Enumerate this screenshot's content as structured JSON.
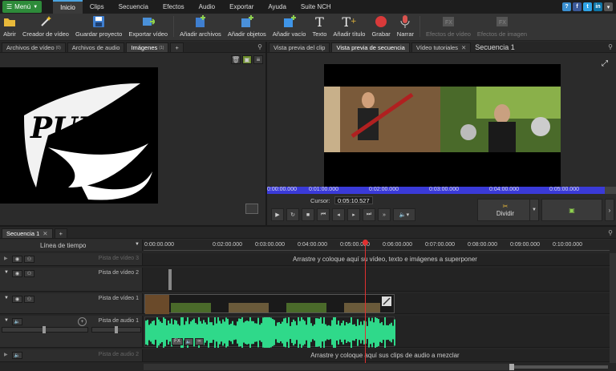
{
  "menubar": {
    "menu_label": "Menú",
    "tabs": [
      "Inicio",
      "Clips",
      "Secuencia",
      "Efectos",
      "Audio",
      "Exportar",
      "Ayuda",
      "Suite NCH"
    ],
    "social": [
      {
        "icon": "help-icon",
        "glyph": "?",
        "color": "#3a8fd0"
      },
      {
        "icon": "facebook-icon",
        "glyph": "f",
        "color": "#3b5998"
      },
      {
        "icon": "twitter-icon",
        "glyph": "t",
        "color": "#2ea3e6"
      },
      {
        "icon": "linkedin-icon",
        "glyph": "in",
        "color": "#0e76a8"
      },
      {
        "icon": "more-icon",
        "glyph": "▾",
        "color": "#555"
      }
    ]
  },
  "toolbar": {
    "items": [
      {
        "label": "Abrir",
        "icon": "folder-icon"
      },
      {
        "label": "Creador de vídeo",
        "icon": "wand-icon"
      },
      {
        "label": "Guardar proyecto",
        "icon": "save-icon"
      },
      {
        "label": "Exportar vídeo",
        "icon": "export-video-icon"
      },
      {
        "label": "Añadir archivos",
        "icon": "add-files-icon"
      },
      {
        "label": "Añadir objetos",
        "icon": "add-objects-icon"
      },
      {
        "label": "Añadir vacío",
        "icon": "add-blank-icon"
      },
      {
        "label": "Texto",
        "icon": "text-icon"
      },
      {
        "label": "Añadir título",
        "icon": "title-icon"
      },
      {
        "label": "Grabar",
        "icon": "record-icon"
      },
      {
        "label": "Narrar",
        "icon": "microphone-icon"
      },
      {
        "label": "Efectos de vídeo",
        "icon": "video-fx-icon"
      },
      {
        "label": "Efectos de imagen",
        "icon": "image-fx-icon"
      }
    ]
  },
  "media_panel": {
    "tabs": [
      {
        "label": "Archivos de vídeo",
        "badge": "(0)"
      },
      {
        "label": "Archivos de audio",
        "badge": ""
      },
      {
        "label": "Imágenes",
        "badge": "(1)"
      }
    ],
    "add_tab": "+",
    "thumbnail_text": "PUKU"
  },
  "preview_panel": {
    "tabs": [
      "Vista previa del clip",
      "Vista previa de secuencia",
      "Vídeo tutoriales"
    ],
    "title": "Secuencia 1",
    "ruler": [
      "0:00:00.000",
      "0:01:00.000",
      "0:02:00.000",
      "0:03:00.000",
      "0:04:00.000",
      "0:05:00.000"
    ],
    "cursor_label": "Cursor:",
    "cursor_value": "0:05:10.527",
    "split_label": "Dividir"
  },
  "sequence": {
    "tab_label": "Secuencia 1",
    "timeline_label": "Línea de tiempo",
    "ruler": [
      "0:00:00.000",
      "0:02:00.000",
      "0:03:00.000",
      "0:04:00.000",
      "0:05:00.000",
      "0:06:00.000",
      "0:07:00.000",
      "0:08:00.000",
      "0:09:00.000",
      "0:10:00.000"
    ],
    "tracks": [
      {
        "name": "Pista de vídeo 3",
        "hint": "Arrastre y coloque aquí su vídeo, texto e imágenes a superponer"
      },
      {
        "name": "Pista de vídeo 2",
        "hint": ""
      },
      {
        "name": "Pista de vídeo 1",
        "hint": ""
      },
      {
        "name": "Pista de audio 1",
        "hint": ""
      },
      {
        "name": "Pista de audio 2",
        "hint": "Arrastre y coloque aquí sus clips de audio a mezclar"
      }
    ],
    "audio_fx_label": "FX"
  },
  "colors": {
    "accent": "#4aa3df",
    "menu_green": "#2e8b3a",
    "ruler_blue": "#3a3ad8",
    "waveform": "#2fd98a",
    "playhead": "#e03030"
  }
}
